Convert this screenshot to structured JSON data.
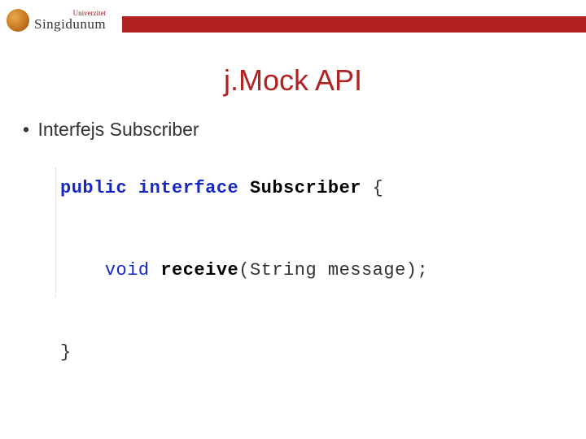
{
  "header": {
    "logo_small": "Univerzitet",
    "logo_big": "Singidunum"
  },
  "title": "j.Mock API",
  "bullet": "Interfejs Subscriber",
  "code": {
    "line1_kw1": "public",
    "line1_kw2": "interface",
    "line1_name": "Subscriber",
    "line1_brace": " {",
    "line2_kw": "void",
    "line2_name": "receive",
    "line2_params": "(String message);",
    "line3": "}"
  }
}
